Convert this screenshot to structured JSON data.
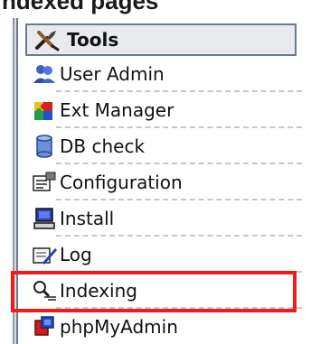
{
  "page_heading": "ndexed pages",
  "menu": {
    "title": "Tools",
    "title_icon": "wrench-screwdriver-icon",
    "items": [
      {
        "label": "User Admin",
        "icon": "users-icon"
      },
      {
        "label": "Ext Manager",
        "icon": "puzzle-icon"
      },
      {
        "label": "DB check",
        "icon": "database-icon"
      },
      {
        "label": "Configuration",
        "icon": "config-icon"
      },
      {
        "label": "Install",
        "icon": "computer-icon"
      },
      {
        "label": "Log",
        "icon": "log-icon"
      },
      {
        "label": "Indexing",
        "icon": "magnifier-icon",
        "highlighted": true
      },
      {
        "label": "phpMyAdmin",
        "icon": "phpmyadmin-icon"
      }
    ]
  },
  "colors": {
    "highlight": "#ee1c1c",
    "header_border": "#6a7b8c",
    "header_bg": "#e8eaee"
  }
}
